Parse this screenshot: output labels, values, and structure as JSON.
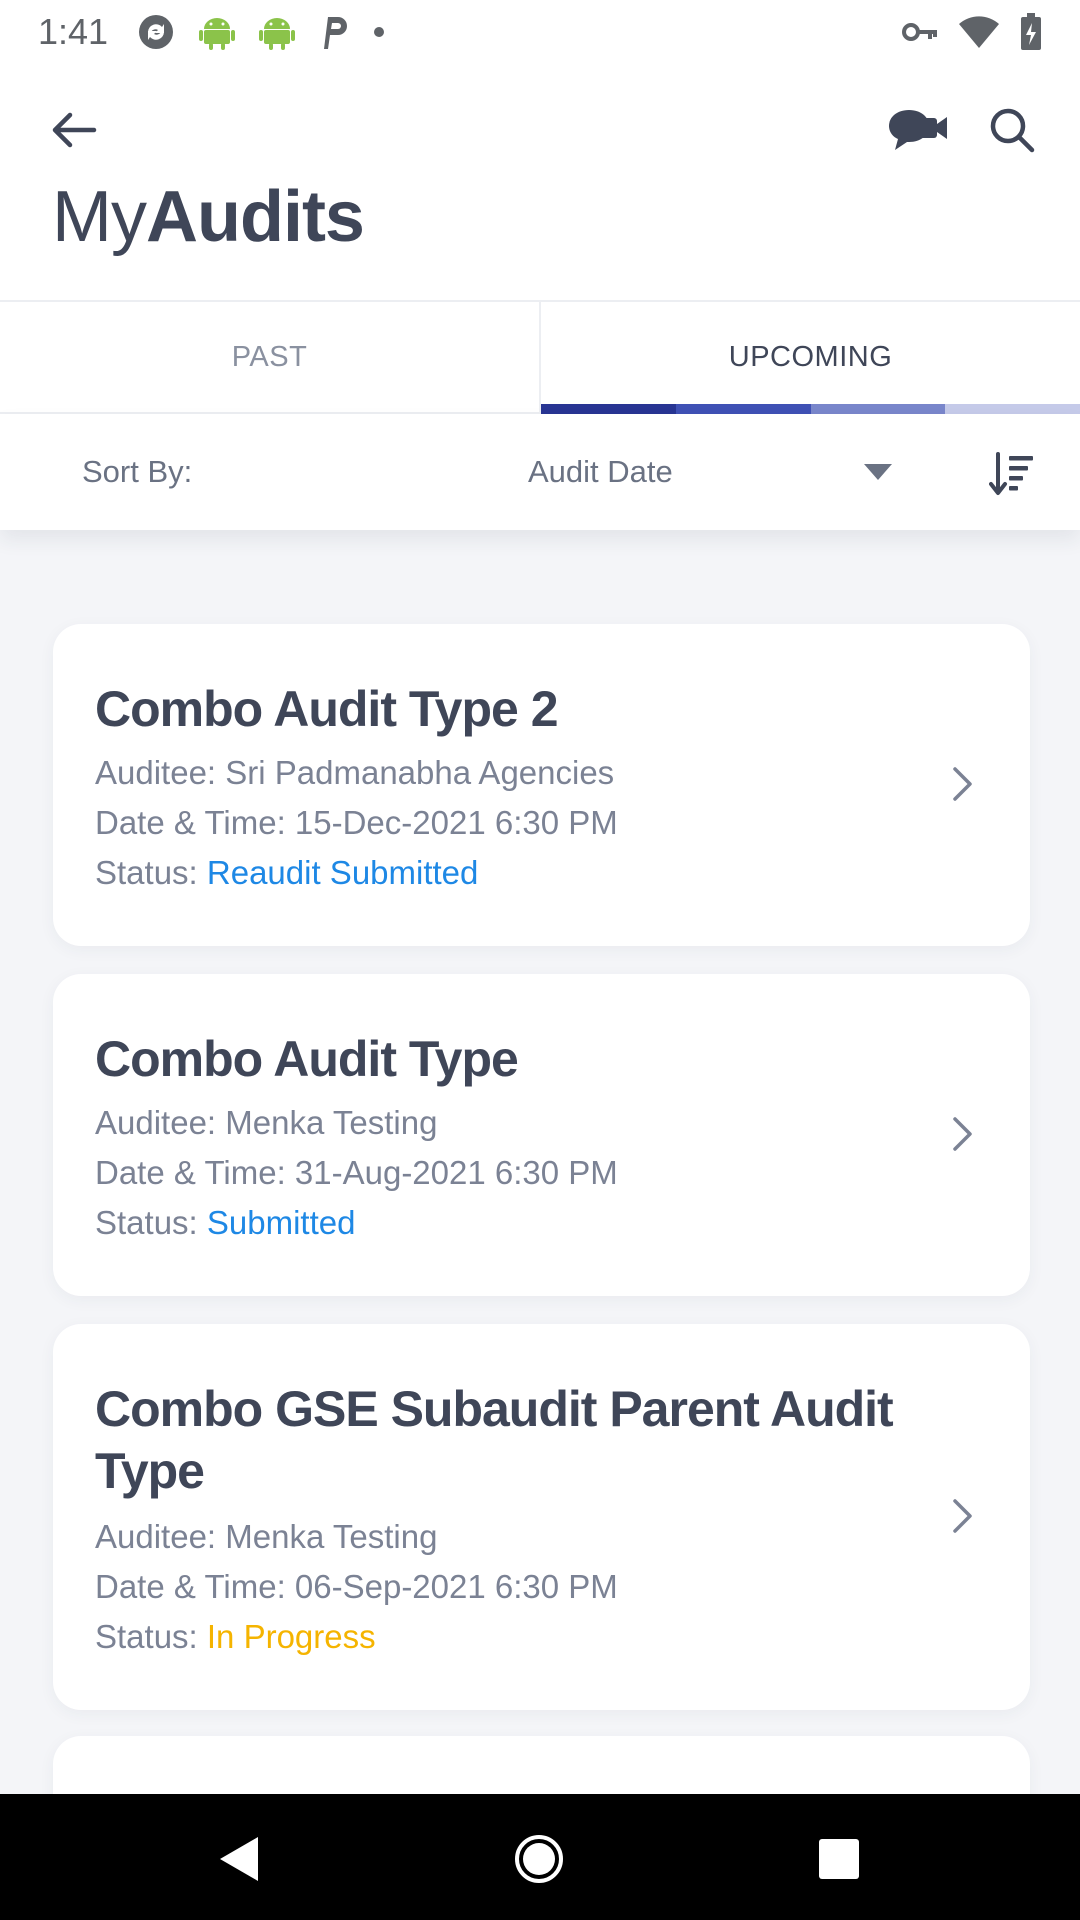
{
  "status_bar": {
    "time": "1:41",
    "left_icons": [
      "sync-icon",
      "android-icon",
      "android-icon",
      "parking-icon",
      "dot-icon"
    ],
    "right_icons": [
      "key-icon",
      "wifi-icon",
      "battery-icon"
    ]
  },
  "header": {
    "back_icon": "arrow-left-icon",
    "video_icon": "video-chat-icon",
    "search_icon": "search-icon",
    "title_part1": "My",
    "title_part2": "Audits"
  },
  "tabs": [
    {
      "label": "PAST",
      "active": false
    },
    {
      "label": "UPCOMING",
      "active": true
    }
  ],
  "tab_indicator_colors": [
    "#283593",
    "#3f51b5",
    "#7986cb",
    "#c5cae9"
  ],
  "sort": {
    "label": "Sort By:",
    "value": "Audit Date",
    "order_icon": "sort-descending-icon"
  },
  "audits": [
    {
      "title": "Combo Audit Type 2",
      "auditee": "Auditee: Sri Padmanabha Agencies",
      "date_time": "Date & Time: 15-Dec-2021 6:30 PM",
      "status_label": "Status: ",
      "status": "Reaudit Submitted",
      "status_color": "#1e88e5"
    },
    {
      "title": "Combo Audit Type",
      "auditee": "Auditee: Menka Testing",
      "date_time": "Date & Time: 31-Aug-2021 6:30 PM",
      "status_label": "Status: ",
      "status": "Submitted",
      "status_color": "#1e88e5"
    },
    {
      "title": "Combo GSE Subaudit Parent Audit Type",
      "auditee": "Auditee: Menka Testing",
      "date_time": "Date & Time: 06-Sep-2021 6:30 PM",
      "status_label": "Status: ",
      "status": "In Progress",
      "status_color": "#f5b400"
    }
  ],
  "nav": {
    "back_icon": "triangle-back-icon",
    "home_icon": "circle-home-icon",
    "recents_icon": "square-recents-icon"
  },
  "colors": {
    "text_primary": "#3f4658",
    "text_secondary": "#7b8294",
    "background": "#f4f5f8"
  }
}
